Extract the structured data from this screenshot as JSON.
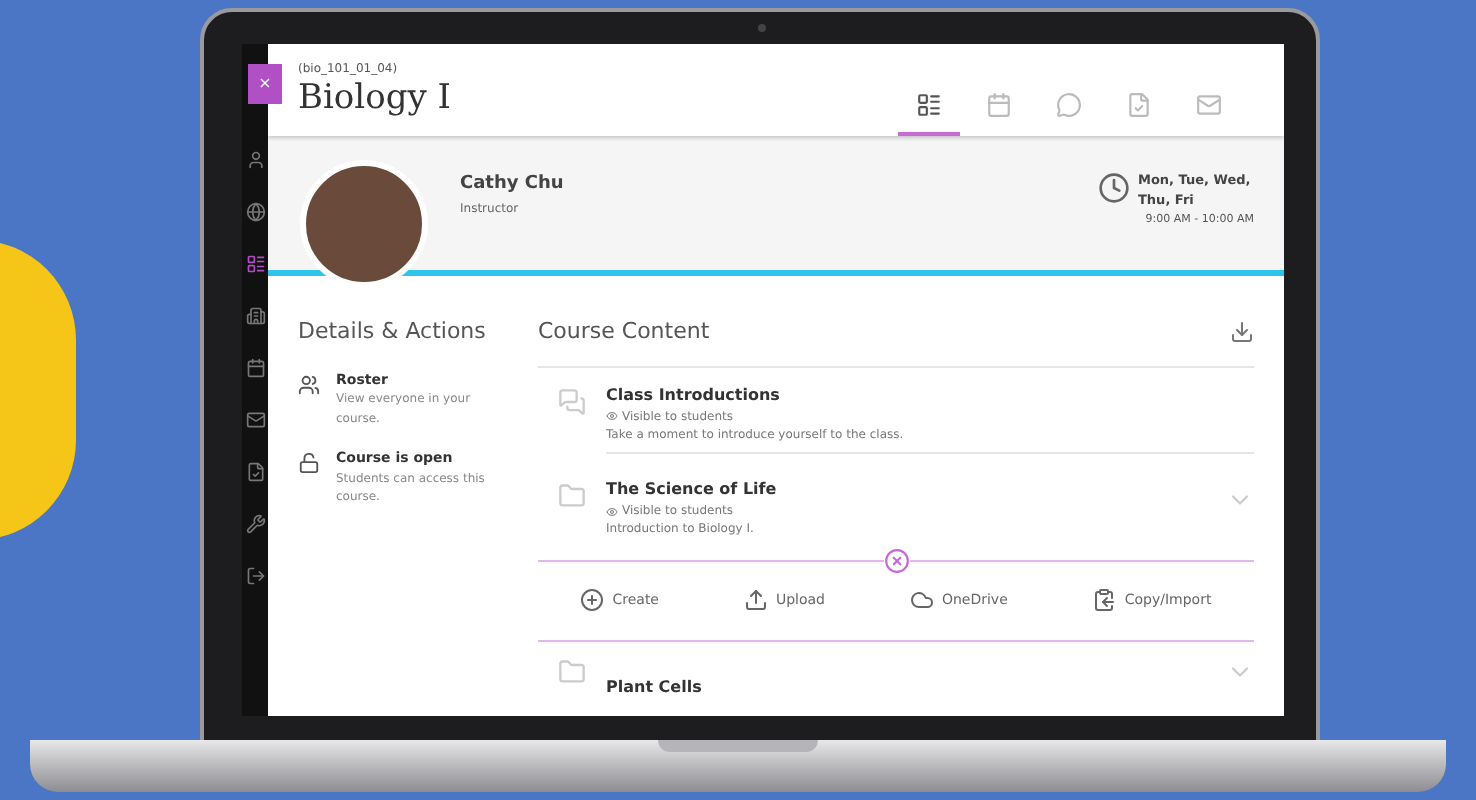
{
  "sidebar": {
    "items": [
      {
        "kind": "user",
        "selected": false
      },
      {
        "kind": "globe",
        "selected": false
      },
      {
        "kind": "course",
        "selected": true
      },
      {
        "kind": "org",
        "selected": false
      },
      {
        "kind": "calendar",
        "selected": false
      },
      {
        "kind": "mail",
        "selected": false
      },
      {
        "kind": "grades",
        "selected": false
      },
      {
        "kind": "tools",
        "selected": false
      },
      {
        "kind": "logout",
        "selected": false
      }
    ]
  },
  "close_tab": {
    "label": "×"
  },
  "course": {
    "code": "(bio_101_01_04)",
    "title": "Biology I"
  },
  "header_tabs": [
    {
      "kind": "content",
      "selected": true
    },
    {
      "kind": "calendar",
      "selected": false
    },
    {
      "kind": "discussion",
      "selected": false
    },
    {
      "kind": "grades",
      "selected": false
    },
    {
      "kind": "mail",
      "selected": false
    }
  ],
  "instructor": {
    "name": "Cathy Chu",
    "role": "Instructor"
  },
  "schedule": {
    "days": "Mon, Tue, Wed, Thu, Fri",
    "time": "9:00 AM - 10:00 AM"
  },
  "details": {
    "title": "Details & Actions",
    "items": [
      {
        "kind": "roster",
        "title": "Roster",
        "description": "View everyone in your course."
      },
      {
        "kind": "lock",
        "title": "Course is open",
        "description": "Students can access this course."
      }
    ]
  },
  "course_content": {
    "title": "Course Content",
    "items": [
      {
        "kind": "discussion",
        "title": "Class Introductions",
        "visibility": "Visible to students",
        "description": "Take a moment to introduce yourself to the class.",
        "expandable": false
      },
      {
        "kind": "folder",
        "title": "The Science of Life",
        "visibility": "Visible to students",
        "description": "Introduction to Biology I.",
        "expandable": true
      }
    ],
    "actions": [
      {
        "kind": "create",
        "label": "Create"
      },
      {
        "kind": "upload",
        "label": "Upload"
      },
      {
        "kind": "cloud",
        "label": "OneDrive"
      },
      {
        "kind": "copy",
        "label": "Copy/Import"
      }
    ],
    "more_items": [
      {
        "kind": "folder",
        "title": "Plant Cells",
        "expandable": true
      }
    ]
  }
}
